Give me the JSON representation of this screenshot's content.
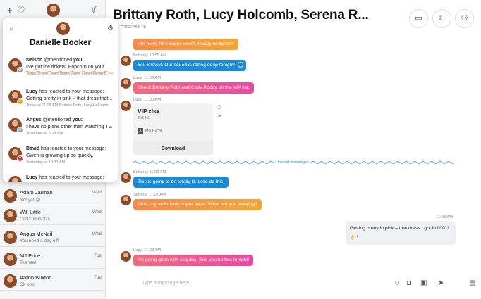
{
  "sidebar": {
    "top_icons": [
      "plus-icon",
      "heart-icon",
      "phone-icon"
    ],
    "contacts": [
      {
        "name": "Adam Jarman",
        "message": "Not yet 😕",
        "day": "Wed"
      },
      {
        "name": "Will Little",
        "message": "Call 10min 32s",
        "day": "Wed"
      },
      {
        "name": "Angus McNeil",
        "message": "You need a day off!",
        "day": "Wed"
      },
      {
        "name": "MJ Price",
        "message": "Teehee!",
        "day": "Tue"
      },
      {
        "name": "Aaron Buxton",
        "message": "Ok cool",
        "day": "Tue"
      }
    ]
  },
  "notifications": {
    "user_name": "Danielle Booker",
    "items": [
      {
        "actor": "Nelson",
        "action": " @mentioned ",
        "target": "you:",
        "message": "I've got the tickets. Popcorn on you!",
        "meta": "Today at 9:40 AM   Brittany Roth, Lucy Holcomb...",
        "badge": "grey"
      },
      {
        "actor": "Lucy",
        "action": " has reacted to your message:",
        "target": "",
        "message": "Getting pretty in pink – that dress that...",
        "meta": "Today at 11:08 AM   Brittany Roth, Lucy Holcomb...",
        "badge": "orange"
      },
      {
        "actor": "Angus",
        "action": " @mentioned ",
        "target": "you:",
        "message": "I have no plans other than watching TV.",
        "meta": "Yesterday at 6:23 PM",
        "badge": "grey"
      },
      {
        "actor": "David",
        "action": " has reacted to your message:",
        "target": "",
        "message": "Gwen is growing up so quickly.",
        "meta": "Yesterday at 10:37 AM",
        "badge": "red"
      },
      {
        "actor": "Lucy",
        "action": " has reacted to your message:",
        "target": "",
        "message": "",
        "meta": "",
        "badge": "orange"
      }
    ]
  },
  "header": {
    "title": "Brittany Roth, Lucy Holcomb, Serena R...",
    "subtitle": "RTICIPANTS"
  },
  "messages": {
    "m1": {
      "text": "Um hello, he's super sweet. Ready to dance?"
    },
    "m2": {
      "meta": "Brittany, 10:59 AM",
      "text": "You know it. Our squad is rolling deep tonight!"
    },
    "m3": {
      "meta": "Lucy, 11:00 AM",
      "text": "Check Brittany Roth and Cody Roddy on the VIP list."
    },
    "m4": {
      "meta": "Lucy, 11:00 AM"
    },
    "file": {
      "name": "VIP.xlsx",
      "size": "252 KB",
      "type": "MS Excel",
      "download": "Download"
    },
    "unread": "Unread messages",
    "m5": {
      "meta": "Brittany, 11:02 AM",
      "text": "This is going to be totally lit. Let's do this!"
    },
    "m6": {
      "meta": "Serena, 11:07 AM",
      "text": "Girls, my outfit feels super basic. What are you wearing?"
    },
    "own": {
      "meta": "11:08 AM",
      "text": "Getting pretty in pink – that dress I got in NYC!",
      "reaction": "👌 1"
    },
    "m7": {
      "meta": "Lucy, 11:08 AM",
      "text": "I'm going glam with sequins. See you hotties tonight!"
    }
  },
  "composer": {
    "placeholder": "Type a message here"
  }
}
